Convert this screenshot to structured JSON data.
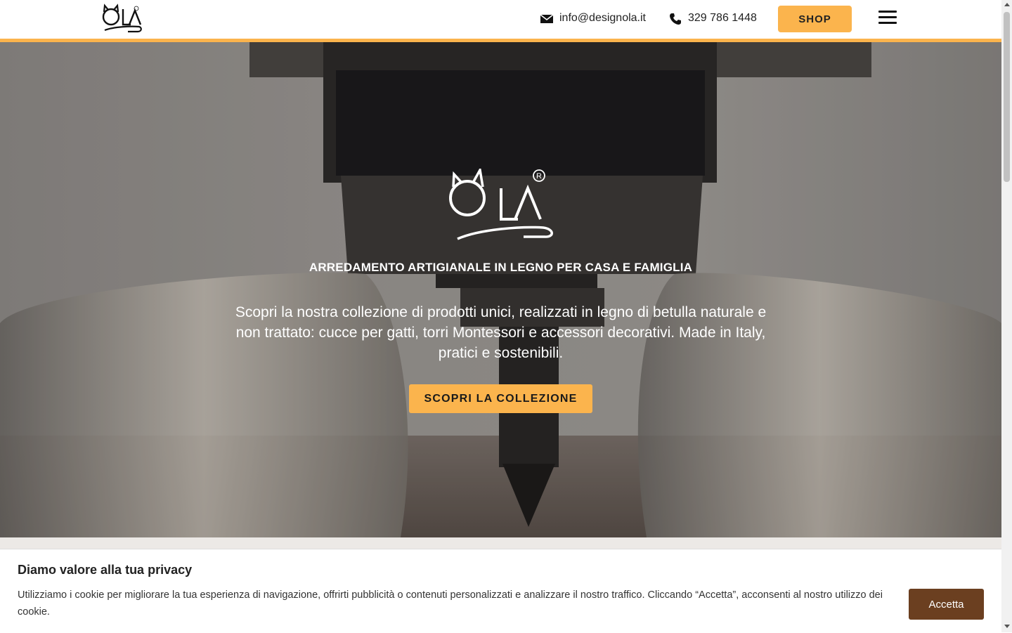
{
  "header": {
    "logo_icon": "ola-logo-icon",
    "email": "info@designola.it",
    "email_icon": "mail-icon",
    "phone": "329 786 1448",
    "phone_icon": "phone-icon",
    "shop_label": "SHOP",
    "menu_icon": "hamburger-menu-icon",
    "accent_color": "#fbb44d"
  },
  "hero": {
    "logo_icon": "ola-logo-icon",
    "tagline": "ARREDAMENTO ARTIGIANALE IN LEGNO PER CASA E FAMIGLIA",
    "description": "Scopri la nostra collezione di prodotti unici, realizzati in legno di betulla naturale e non trattato: cucce per gatti, torri Montessori e accessori decorativi. Made in Italy, pratici e sostenibili.",
    "cta_label": "SCOPRI LA COLLEZIONE"
  },
  "cookie": {
    "title": "Diamo valore alla tua privacy",
    "text": "Utilizziamo i cookie per migliorare la tua esperienza di navigazione, offrirti pubblicità o contenuti personalizzati e analizzare il nostro traffico. Cliccando “Accetta”, acconsenti al nostro utilizzo dei cookie.",
    "accept_label": "Accetta",
    "accept_color": "#6b3f20"
  }
}
